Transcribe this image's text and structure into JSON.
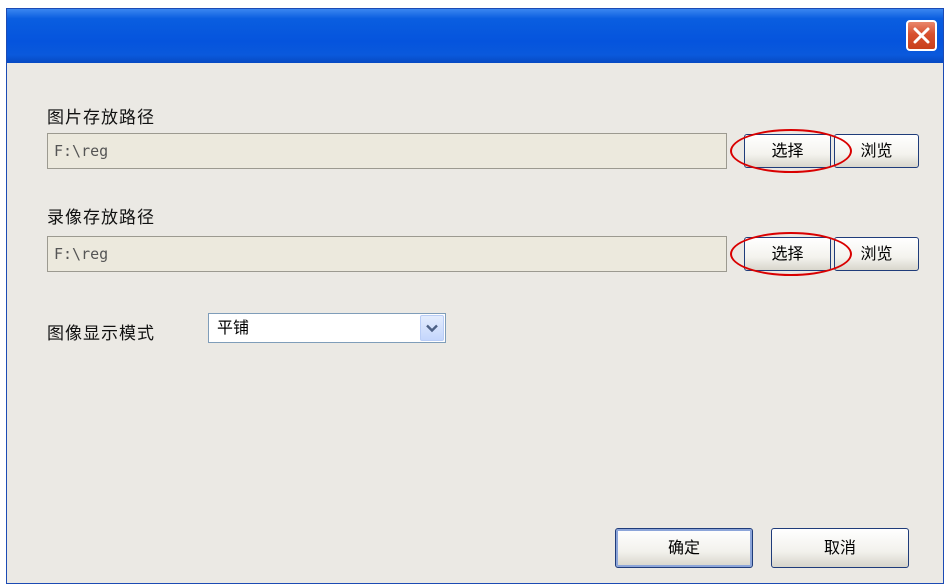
{
  "window": {
    "title": "",
    "close_icon": "close-icon"
  },
  "image_path": {
    "label": "图片存放路径",
    "value": "F:\\reg",
    "select_label": "选择",
    "browse_label": "浏览"
  },
  "video_path": {
    "label": "录像存放路径",
    "value": "F:\\reg",
    "select_label": "选择",
    "browse_label": "浏览"
  },
  "display_mode": {
    "label": "图像显示模式",
    "selected": "平铺",
    "arrow_icon": "chevron-down-icon"
  },
  "footer": {
    "ok_label": "确定",
    "cancel_label": "取消"
  },
  "colors": {
    "titlebar": "#0554dd",
    "close_button": "#d8502f",
    "dialog_background": "#ebe9e4",
    "field_background": "#ece9dd",
    "highlight": "#d90000"
  }
}
